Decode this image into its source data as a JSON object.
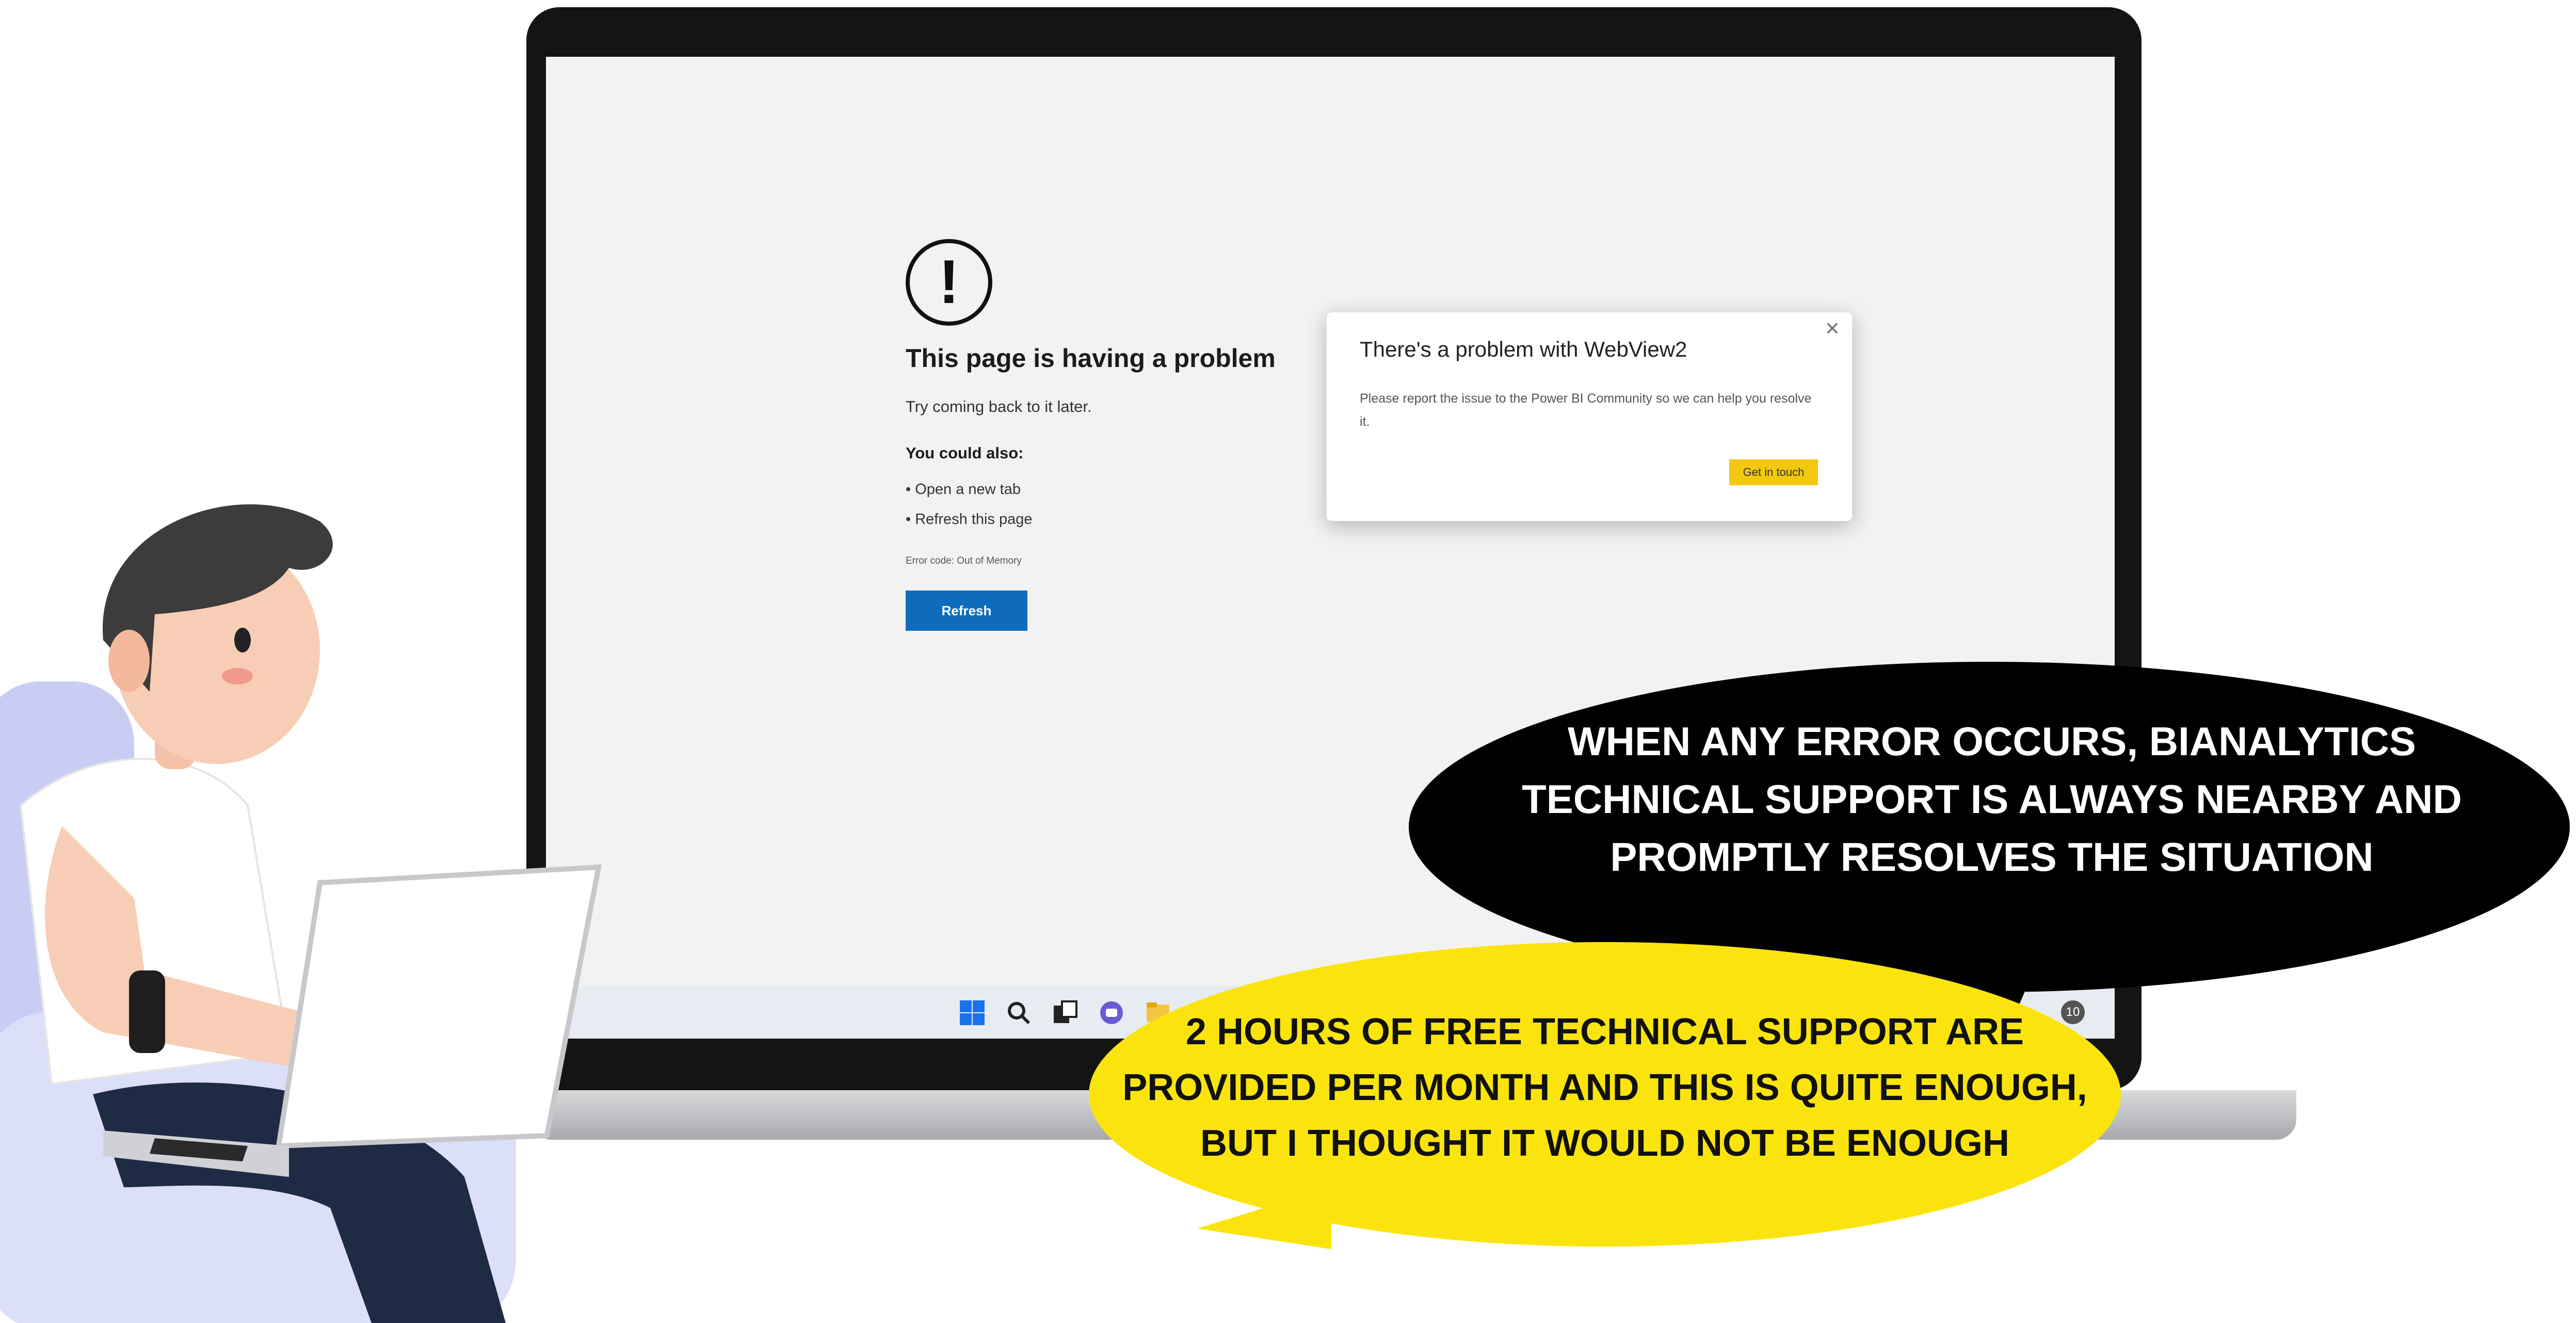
{
  "error_page": {
    "title": "This page is having a problem",
    "subtitle": "Try coming back to it later.",
    "also_heading": "You could also:",
    "options": [
      "Open a new tab",
      "Refresh this page"
    ],
    "error_code": "Error code: Out of Memory",
    "refresh_button": "Refresh",
    "icon": "exclamation-circle-icon"
  },
  "dialog": {
    "title": "There's a problem with WebView2",
    "body": "Please report the issue to the Power BI Community so we can help you resolve it.",
    "button": "Get in touch",
    "close_icon": "close-icon",
    "button_color": "#f2c811"
  },
  "taskbar": {
    "icons": [
      "windows-start-icon",
      "search-icon",
      "task-view-icon",
      "teams-chat-icon",
      "file-explorer-icon"
    ],
    "badge": "10"
  },
  "bubbles": {
    "black_text": "WHEN ANY ERROR OCCURS, BIANALYTICS TECHNICAL SUPPORT IS ALWAYS NEARBY AND PROMPTLY RESOLVES THE SITUATION",
    "yellow_text": "2 HOURS OF FREE TECHNICAL SUPPORT ARE PROVIDED PER MONTH AND THIS IS QUITE ENOUGH, BUT I THOUGHT IT WOULD NOT BE ENOUGH",
    "yellow_color": "#fbe40d"
  },
  "colors": {
    "accent_blue": "#0f6cbd",
    "screen_bg": "#f2f2f2"
  }
}
